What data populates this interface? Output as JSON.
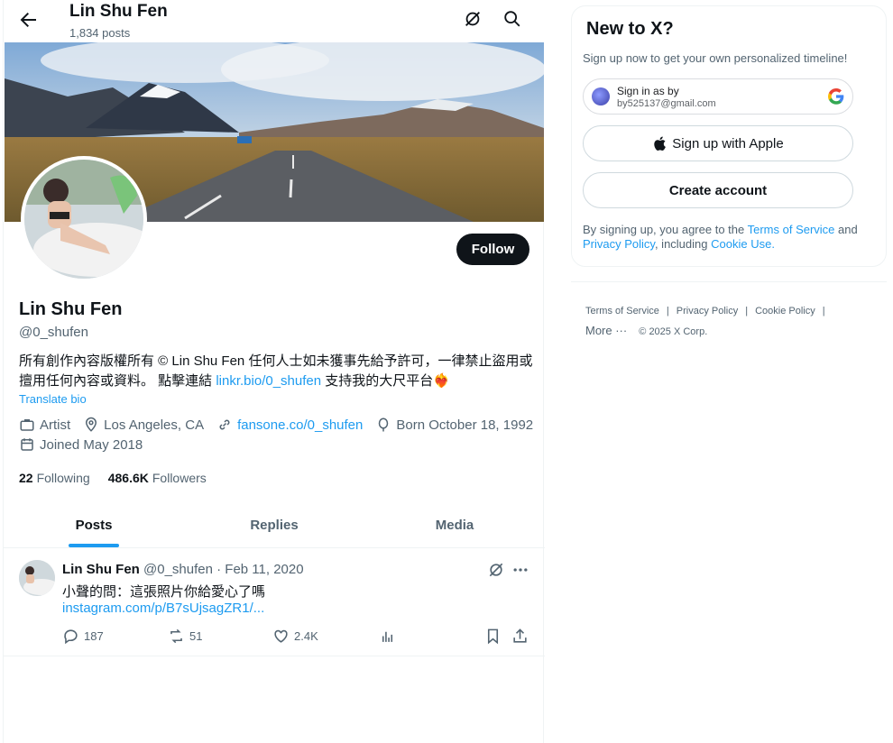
{
  "header": {
    "name": "Lin Shu Fen",
    "posts_count": "1,834 posts"
  },
  "profile": {
    "name": "Lin Shu Fen",
    "handle": "@0_shufen",
    "follow_label": "Follow",
    "bio_text_1": "所有創作內容版權所有 © Lin Shu Fen 任何人士如未獲事先給予許可，一律禁止盜用或擅用任何內容或資料。 點擊連結 ",
    "bio_link": "linkr.bio/0_shufen",
    "bio_text_2": " 支持我的大尺平台",
    "bio_emoji": "❤️‍🔥",
    "translate_label": "Translate bio",
    "category": "Artist",
    "location": "Los Angeles, CA",
    "website": "fansone.co/0_shufen",
    "birthday": "Born October 18, 1992",
    "joined": "Joined May 2018",
    "following_count": "22",
    "following_label": "Following",
    "followers_count": "486.6K",
    "followers_label": "Followers"
  },
  "tabs": [
    {
      "label": "Posts",
      "active": true
    },
    {
      "label": "Replies",
      "active": false
    },
    {
      "label": "Media",
      "active": false
    }
  ],
  "post": {
    "author": "Lin Shu Fen",
    "meta": "@0_shufen · Feb 11, 2020",
    "text": "小聲的問：這張照片你給愛心了嗎",
    "link": "instagram.com/p/B7sUjsagZR1/...",
    "replies": "187",
    "reposts": "51",
    "likes": "2.4K"
  },
  "sidebar": {
    "title": "New to X?",
    "subtitle": "Sign up now to get your own personalized timeline!",
    "google_line1": "Sign in as by",
    "google_line2": "by525137@gmail.com",
    "apple_label": "Sign up with Apple",
    "create_label": "Create account",
    "legal_prefix": "By signing up, you agree to the ",
    "terms_link": "Terms of Service",
    "legal_and": " and ",
    "privacy_link": "Privacy Policy",
    "legal_including": ", including ",
    "cookie_link": "Cookie Use",
    "legal_end": "."
  },
  "footer": {
    "terms": "Terms of Service",
    "privacy": "Privacy Policy",
    "cookie": "Cookie Policy",
    "more": "More ···",
    "copyright": "© 2025 X Corp."
  },
  "colors": {
    "accent": "#1d9bf0",
    "text": "#0f1419",
    "muted": "#536471"
  }
}
